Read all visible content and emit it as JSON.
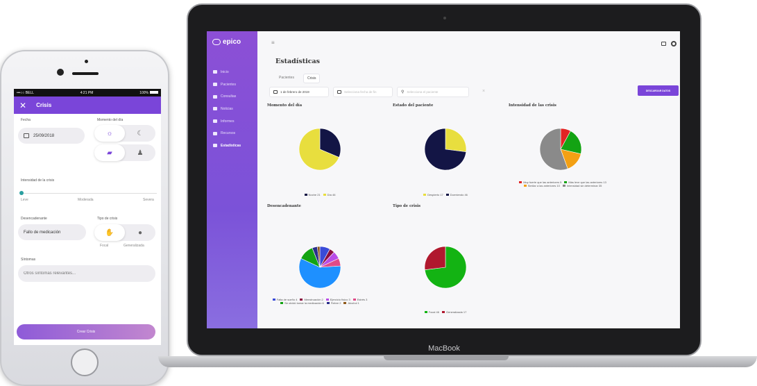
{
  "phone": {
    "status": {
      "carrier": "•••○○ BELL",
      "time": "4:21 PM",
      "battery": "100%"
    },
    "header": {
      "title": "Crisis"
    },
    "form": {
      "fecha_label": "Fecha",
      "fecha_value": "25/09/2018",
      "momento_label": "Momento del día",
      "intensidad_label": "Intensidad de la crisis",
      "intensidad_levels": [
        "Leve",
        "Moderada",
        "Severa"
      ],
      "intensidad_value": 0,
      "desencadenante_label": "Desencadenante",
      "desencadenante_value": "Fallo de medicación",
      "tipo_label": "Tipo de crisis",
      "tipo_options": [
        "Focal",
        "Generalizada"
      ],
      "sintomas_label": "Síntomas",
      "sintomas_placeholder": "Otros síntomas relevantes...",
      "submit_label": "Crear Crisis"
    }
  },
  "laptop": {
    "brand": "MacBook"
  },
  "app": {
    "logo": "epico",
    "nav": [
      "Inicio",
      "Pacientes",
      "Consultas",
      "Noticias",
      "Informes",
      "Recursos",
      "Estadísticas"
    ],
    "title": "Estadísticas",
    "tabs": [
      "Pacientes",
      "Crisis"
    ],
    "filters": {
      "date_from": "1 de febrero de 2019",
      "date_to": "Selecciona fecha de fin",
      "patient": "Selecciona el paciente",
      "clear": "×"
    },
    "download_label": "DESCARGAR DATOS"
  },
  "chart_data": [
    {
      "type": "pie",
      "title": "Momento del día",
      "series": [
        {
          "name": "Noche",
          "value": 21,
          "color": "#131545"
        },
        {
          "name": "Día",
          "value": 46,
          "color": "#e8de3e"
        }
      ]
    },
    {
      "type": "pie",
      "title": "Estado del paciente",
      "series": [
        {
          "name": "Despierto",
          "value": 17,
          "color": "#e8de3e"
        },
        {
          "name": "Durmiendo",
          "value": 46,
          "color": "#131545"
        }
      ]
    },
    {
      "type": "pie",
      "title": "Intensidad de las crisis",
      "series": [
        {
          "name": "Muy fuerte que las anteriores",
          "value": 5,
          "color": "#e22424"
        },
        {
          "name": "Más leve que las anteriores",
          "value": 13,
          "color": "#13a313"
        },
        {
          "name": "Similar a las anteriores",
          "value": 10,
          "color": "#f3a014"
        },
        {
          "name": "Intensidad sin determinar",
          "value": 35,
          "color": "#8a8a8a"
        }
      ]
    },
    {
      "type": "pie",
      "title": "Desencadenante",
      "series": [
        {
          "name": "Falta de sueño",
          "value": 4,
          "color": "#3a4bd8"
        },
        {
          "name": "Menstruación",
          "value": 2,
          "color": "#8a1040"
        },
        {
          "name": "Ejercicio físico",
          "value": 3,
          "color": "#b94ce6"
        },
        {
          "name": "Estrés",
          "value": 3,
          "color": "#e04a88"
        },
        {
          "name": "—",
          "value": 29,
          "color": "#1e90ff"
        },
        {
          "name": "Se olvidó tomar la medicación",
          "value": 6,
          "color": "#13a313"
        },
        {
          "name": "Fiebre",
          "value": 2,
          "color": "#2a2e8a"
        },
        {
          "name": "Alcohol",
          "value": 1,
          "color": "#8f5a1c"
        }
      ]
    },
    {
      "type": "pie",
      "title": "Tipo de crisis",
      "series": [
        {
          "name": "Focal",
          "value": 46,
          "color": "#13b313"
        },
        {
          "name": "Generalizada",
          "value": 17,
          "color": "#b0182e"
        }
      ]
    }
  ]
}
